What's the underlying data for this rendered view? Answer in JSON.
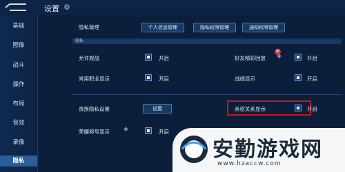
{
  "header": {
    "title": "设置"
  },
  "sidebar": {
    "items": [
      {
        "label": "基础"
      },
      {
        "label": "图像"
      },
      {
        "label": "战斗"
      },
      {
        "label": "操作"
      },
      {
        "label": "布局"
      },
      {
        "label": "音效"
      },
      {
        "label": "录像"
      },
      {
        "label": "隐私",
        "active": true
      }
    ]
  },
  "privacy": {
    "manage_label": "隐私管理",
    "buttons": [
      "个人信息管理",
      "隐私权限管理",
      "通知权限管理"
    ],
    "section_label": "隐私",
    "on_label": "开启",
    "settings_button": "设置",
    "rows": {
      "allow_spectate": "允许观战",
      "friend_replay": "好友精彩回放",
      "common_role": "常用职业显示",
      "battle_record": "战绩显示",
      "noble_privacy": "贵族隐私设置",
      "relation_display": "亲密关系显示",
      "honor_title": "荣耀称号显示"
    },
    "new_badge": "新"
  },
  "watermark": {
    "text": "安勤游戏网",
    "url": "www.hzaccw.com"
  },
  "colors": {
    "background": "#0b1e3a",
    "accent": "#2a5d9a",
    "highlight": "#c2191f"
  }
}
